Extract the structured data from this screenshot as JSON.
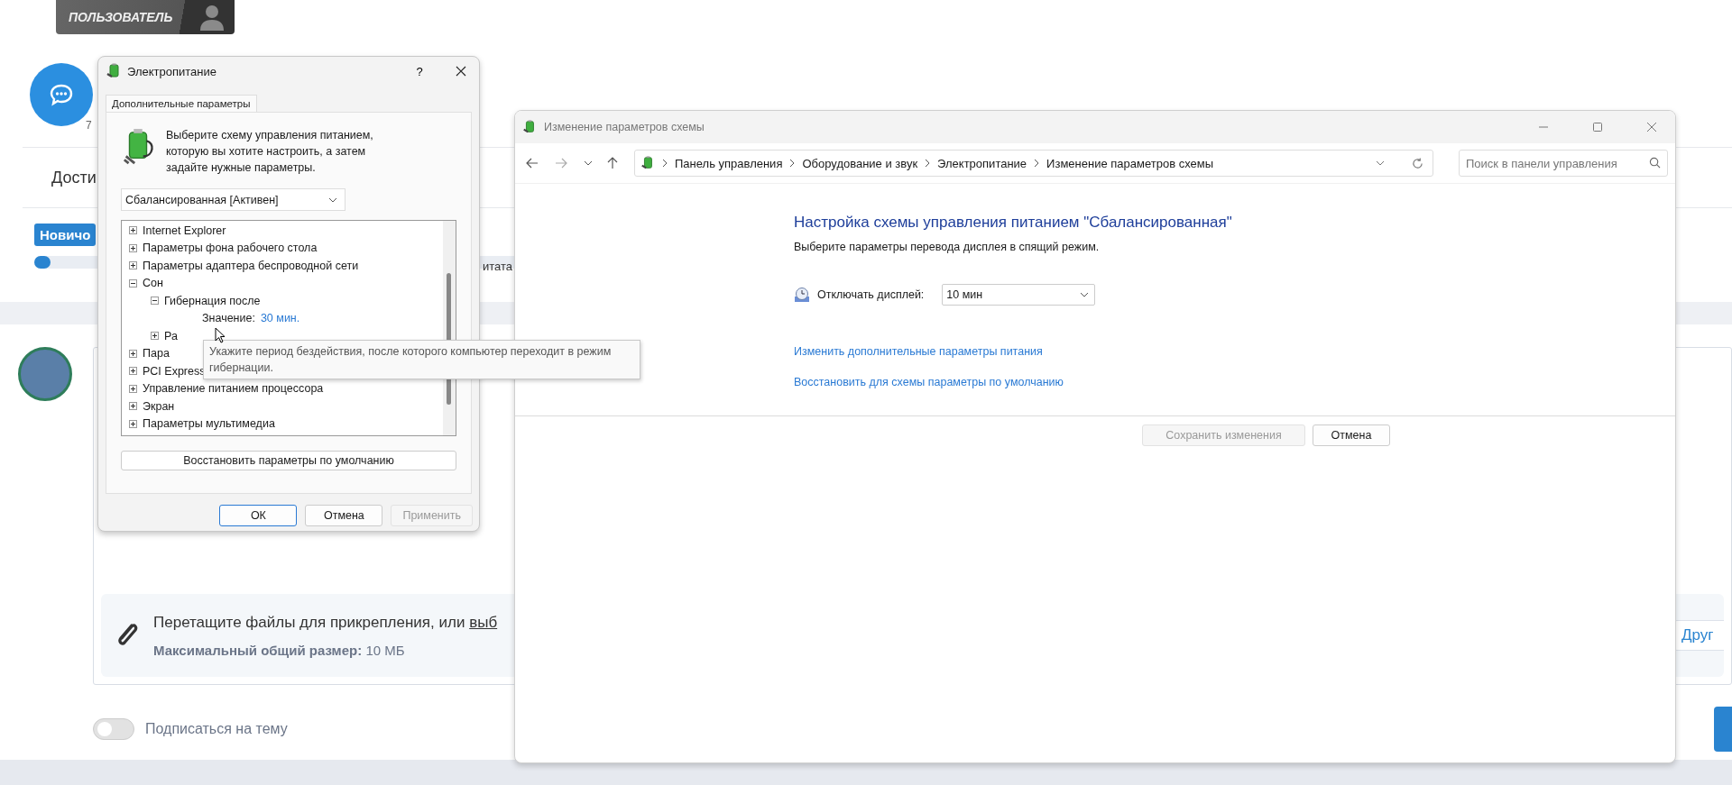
{
  "background_page": {
    "user_badge": "ПОЛЬЗОВАТЕЛЬ",
    "message_count": "7",
    "section_heading": "Дости",
    "rank_badge": "Новичо",
    "progress": {
      "level": 0.01
    },
    "cut_text": "итата",
    "attachments": {
      "prompt": "Перетащите файлы для прикрепления, или",
      "link": "выб",
      "limit_label": "Максимальный общий размер:",
      "limit_value": "10 МБ",
      "side_button": "Друг"
    },
    "subscribe": {
      "label": "Подписаться на тему",
      "on": false
    }
  },
  "power_dialog": {
    "title": "Электропитание",
    "help": "?",
    "tabs": [
      {
        "label": "Дополнительные параметры",
        "selected": true
      }
    ],
    "intro": "Выберите схему управления питанием, которую вы хотите настроить, а затем задайте нужные параметры.",
    "scheme_select": {
      "value": "Сбалансированная [Активен]"
    },
    "tree": [
      {
        "kind": "group",
        "label": "Internet Explorer",
        "expanded": false
      },
      {
        "kind": "group",
        "label": "Параметры фона рабочего стола",
        "expanded": false
      },
      {
        "kind": "group",
        "label": "Параметры адаптера беспроводной сети",
        "expanded": false
      },
      {
        "kind": "group",
        "label": "Сон",
        "expanded": true,
        "children": [
          {
            "kind": "group",
            "label": "Гибернация после",
            "expanded": true,
            "children": [
              {
                "kind": "value",
                "label": "Значение:",
                "value": "30 мин."
              }
            ]
          },
          {
            "kind": "group",
            "label": "Ра",
            "expanded": false
          }
        ]
      },
      {
        "kind": "group",
        "label": "Пара",
        "expanded": false
      },
      {
        "kind": "group",
        "label": "PCI Express",
        "expanded": false
      },
      {
        "kind": "group",
        "label": "Управление питанием процессора",
        "expanded": false
      },
      {
        "kind": "group",
        "label": "Экран",
        "expanded": false
      },
      {
        "kind": "group",
        "label": "Параметры мультимедиа",
        "expanded": false
      }
    ],
    "tooltip": "Укажите период бездействия, после которого компьютер переходит в режим гибернации.",
    "restore_button": "Восстановить параметры по умолчанию",
    "buttons": [
      {
        "label": "ОК",
        "default": true,
        "disabled": false
      },
      {
        "label": "Отмена",
        "default": false,
        "disabled": false
      },
      {
        "label": "Применить",
        "default": false,
        "disabled": true
      }
    ]
  },
  "scheme_window": {
    "title": "Изменение параметров схемы",
    "address": [
      "Панель управления",
      "Оборудование и звук",
      "Электропитание",
      "Изменение параметров схемы"
    ],
    "search": {
      "placeholder": "Поиск в панели управления"
    },
    "heading": "Настройка схемы управления питанием \"Сбалансированная\"",
    "subheading": "Выберите параметры перевода дисплея в спящий режим.",
    "display_setting": {
      "label": "Отключать дисплей:",
      "value": "10 мин"
    },
    "links": [
      "Изменить дополнительные параметры питания",
      "Восстановить для схемы параметры по умолчанию"
    ],
    "buttons": [
      {
        "label": "Сохранить изменения",
        "disabled": true
      },
      {
        "label": "Отмена",
        "disabled": false
      }
    ]
  }
}
